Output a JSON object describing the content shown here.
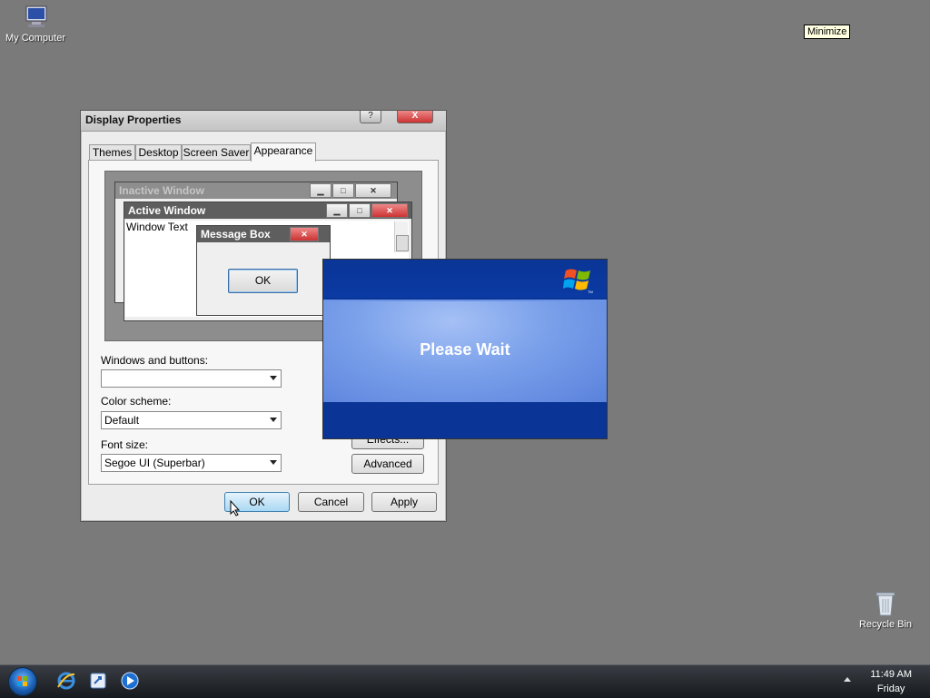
{
  "desktop": {
    "my_computer": "My Computer",
    "recycle_bin": "Recycle Bin",
    "tooltip": "Minimize"
  },
  "window": {
    "title": "Display Properties",
    "help": "?",
    "close": "X",
    "tabs": [
      "Themes",
      "Desktop",
      "Screen Saver",
      "Appearance"
    ],
    "active_tab": "Appearance",
    "preview": {
      "inactive_title": "Inactive Window",
      "active_title": "Active Window",
      "window_text": "Window Text",
      "message_title": "Message Box",
      "message_ok": "OK"
    },
    "windows_buttons_label": "Windows and buttons:",
    "windows_buttons_value": "",
    "color_scheme_label": "Color scheme:",
    "color_scheme_value": "Default",
    "font_size_label": "Font size:",
    "font_size_value": "Segoe UI (Superbar)",
    "effects_button": "Effects...",
    "advanced_button": "Advanced",
    "ok_button": "OK",
    "cancel_button": "Cancel",
    "apply_button": "Apply"
  },
  "splash": {
    "message": "Please Wait"
  },
  "taskbar": {
    "time": "11:49 AM",
    "day": "Friday",
    "icons": [
      "internet-explorer-icon",
      "explorer-icon",
      "media-player-icon"
    ]
  },
  "colors": {
    "splash_blue": "#0a3596",
    "desktop": "#7a7a7a"
  }
}
